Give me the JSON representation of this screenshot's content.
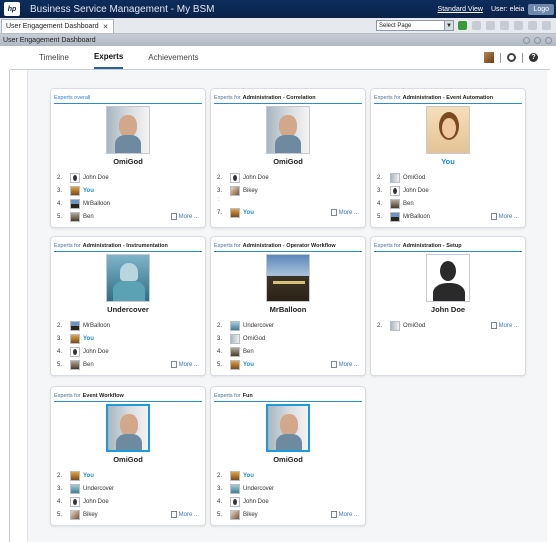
{
  "titlebar": {
    "logo": "hp",
    "title": "Business Service Management - My BSM",
    "standard_view": "Standard View",
    "user_label": "User: eleia",
    "logout": "Logo"
  },
  "tabs": [
    {
      "label": "User Engagement Dashboard"
    }
  ],
  "toolbar": {
    "select_page_placeholder": "Select Page"
  },
  "dashboard_title": "User Engagement Dashboard",
  "nav": {
    "tabs": [
      "Timeline",
      "Experts",
      "Achievements"
    ],
    "active": "Experts"
  },
  "cards": [
    {
      "title_prefix": "Experts overall",
      "title_bold": "",
      "top_name": "OmiGod",
      "top_is_you": false,
      "portrait": "omigod",
      "rows": [
        {
          "rank": "2.",
          "name": "John Doe",
          "avatar": "johndoe",
          "you": false
        },
        {
          "rank": "3.",
          "name": "You",
          "avatar": "you",
          "you": true
        },
        {
          "rank": "4.",
          "name": "MrBalloon",
          "avatar": "mrballoon",
          "you": false
        },
        {
          "rank": "5.",
          "name": "Ben",
          "avatar": "ben",
          "you": false
        }
      ],
      "more": "More ..."
    },
    {
      "title_prefix": "Experts for",
      "title_bold": "Administration - Correlation",
      "top_name": "OmiGod",
      "top_is_you": false,
      "portrait": "omigod",
      "rows": [
        {
          "rank": "2.",
          "name": "John Doe",
          "avatar": "johndoe",
          "you": false
        },
        {
          "rank": "3.",
          "name": "Bikey",
          "avatar": "bikey",
          "you": false
        },
        {
          "rank": "",
          "name": "",
          "ellipsis": ":"
        },
        {
          "rank": "7.",
          "name": "You",
          "avatar": "you",
          "you": true
        }
      ],
      "more": "More ..."
    },
    {
      "title_prefix": "Experts for",
      "title_bold": "Administration - Event Automation",
      "top_name": "You",
      "top_is_you": true,
      "portrait": "you",
      "rows": [
        {
          "rank": "2.",
          "name": "OmiGod",
          "avatar": "omigod",
          "you": false
        },
        {
          "rank": "3.",
          "name": "John Doe",
          "avatar": "johndoe",
          "you": false
        },
        {
          "rank": "4.",
          "name": "Ben",
          "avatar": "ben",
          "you": false
        },
        {
          "rank": "5.",
          "name": "MrBalloon",
          "avatar": "mrballoon",
          "you": false
        }
      ],
      "more": "More ..."
    },
    {
      "title_prefix": "Experts for",
      "title_bold": "Administration - Instrumentation",
      "top_name": "Undercover",
      "top_is_you": false,
      "portrait": "undercover",
      "rows": [
        {
          "rank": "2.",
          "name": "MrBalloon",
          "avatar": "mrballoon",
          "you": false
        },
        {
          "rank": "3.",
          "name": "You",
          "avatar": "you",
          "you": true
        },
        {
          "rank": "4.",
          "name": "John Doe",
          "avatar": "johndoe",
          "you": false
        },
        {
          "rank": "5.",
          "name": "Ben",
          "avatar": "ben",
          "you": false
        }
      ],
      "more": "More ..."
    },
    {
      "title_prefix": "Experts for",
      "title_bold": "Administration - Operator Workflow",
      "top_name": "MrBalloon",
      "top_is_you": false,
      "portrait": "mrballoon",
      "rows": [
        {
          "rank": "2.",
          "name": "Undercover",
          "avatar": "undercover",
          "you": false
        },
        {
          "rank": "3.",
          "name": "OmiGod",
          "avatar": "omigod",
          "you": false
        },
        {
          "rank": "4.",
          "name": "Ben",
          "avatar": "ben",
          "you": false
        },
        {
          "rank": "5.",
          "name": "You",
          "avatar": "you",
          "you": true
        }
      ],
      "more": "More ..."
    },
    {
      "title_prefix": "Experts for",
      "title_bold": "Administration - Setup",
      "top_name": "John Doe",
      "top_is_you": false,
      "portrait": "johndoe",
      "rows": [
        {
          "rank": "2.",
          "name": "OmiGod",
          "avatar": "omigod",
          "you": false
        }
      ],
      "more": "More ..."
    },
    {
      "title_prefix": "Experts for",
      "title_bold": "Event Workflow",
      "top_name": "OmiGod",
      "top_is_you": false,
      "portrait": "omigod",
      "selected": true,
      "rows": [
        {
          "rank": "2.",
          "name": "You",
          "avatar": "you",
          "you": true
        },
        {
          "rank": "3.",
          "name": "Undercover",
          "avatar": "undercover",
          "you": false
        },
        {
          "rank": "4.",
          "name": "John Doe",
          "avatar": "johndoe",
          "you": false
        },
        {
          "rank": "5.",
          "name": "Bikey",
          "avatar": "bikey",
          "you": false
        }
      ],
      "more": "More ..."
    },
    {
      "title_prefix": "Experts for",
      "title_bold": "Fun",
      "top_name": "OmiGod",
      "top_is_you": false,
      "portrait": "omigod",
      "selected": true,
      "rows": [
        {
          "rank": "2.",
          "name": "You",
          "avatar": "you",
          "you": true
        },
        {
          "rank": "3.",
          "name": "Undercover",
          "avatar": "undercover",
          "you": false
        },
        {
          "rank": "4.",
          "name": "John Doe",
          "avatar": "johndoe",
          "you": false
        },
        {
          "rank": "5.",
          "name": "Bikey",
          "avatar": "bikey",
          "you": false
        }
      ],
      "more": "More ..."
    }
  ]
}
